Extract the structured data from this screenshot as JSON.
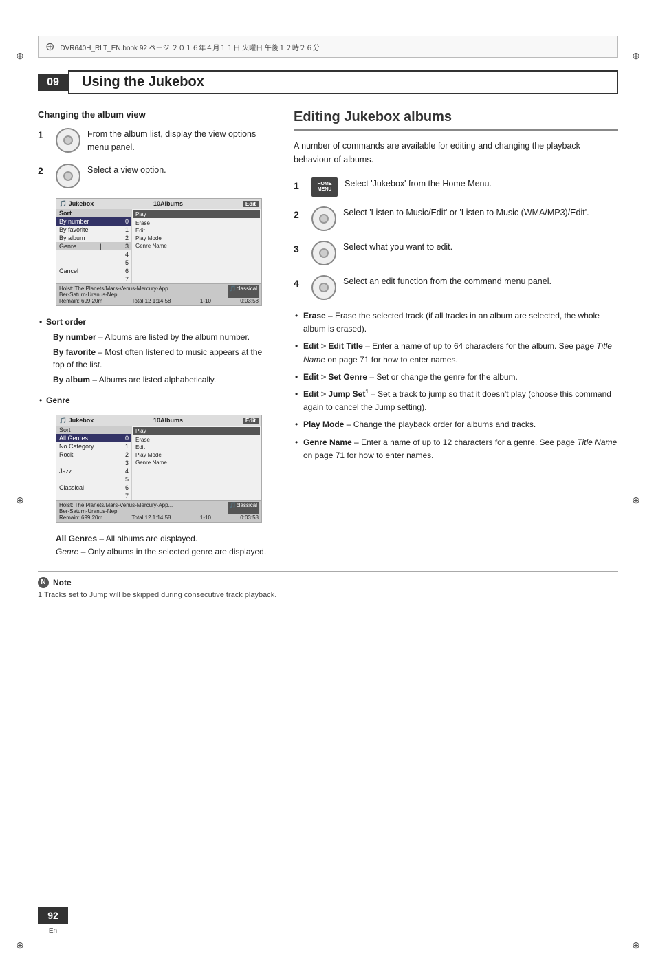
{
  "page": {
    "number": "92",
    "lang": "En"
  },
  "topbar": {
    "text": "DVR640H_RLT_EN.book  92 ページ  ２０１６年４月１１日  火曜日  午後１２時２６分"
  },
  "chapter": {
    "number": "09",
    "title": "Using the Jukebox"
  },
  "left": {
    "section_title": "Changing the album view",
    "steps": [
      {
        "num": "1",
        "text": "From the album list, display the view options menu panel."
      },
      {
        "num": "2",
        "text": "Select a view option."
      }
    ],
    "bullets": [
      {
        "heading": "Sort order",
        "items": [
          {
            "label": "By number",
            "desc": "– Albums are listed by the album number."
          },
          {
            "label": "By favorite",
            "desc": "– Most often listened to music appears at the top of the list."
          },
          {
            "label": "By album",
            "desc": "– Albums are listed alphabetically."
          }
        ]
      },
      {
        "heading": "Genre",
        "items": []
      }
    ],
    "genre_desc": [
      {
        "label": "All Genres",
        "desc": "– All albums are displayed."
      },
      {
        "label": "Genre",
        "desc": "– Only albums in the selected genre are displayed.",
        "italic": true
      }
    ],
    "screen1": {
      "title": "Jukebox",
      "count": "10Albums",
      "menu_label": "Sort",
      "menu_items": [
        "By number",
        "By favorite",
        "By album"
      ],
      "genre_label": "Genre",
      "cancel": "Cancel",
      "right_items": [
        "Play",
        "Erase",
        "Edit",
        "Play Mode",
        "Genre Name"
      ],
      "numbers": [
        "0",
        "1",
        "2",
        "3",
        "4",
        "5",
        "6",
        "7"
      ],
      "footer": "Remain: 699:20m",
      "footer2": "Total 12  1:14:58",
      "footer3": "1-10",
      "footer4": "0:03:58"
    },
    "screen2": {
      "title": "Jukebox",
      "count": "10Albums",
      "menu_label": "Sort",
      "genre_label": "All Genres",
      "genre_items": [
        "No Category",
        "Rock",
        "Jazz",
        "Classical"
      ],
      "right_items": [
        "Play",
        "Erase",
        "Edit",
        "Play Mode",
        "Genre Name"
      ],
      "numbers": [
        "0",
        "1",
        "2",
        "3",
        "4",
        "5",
        "6",
        "7"
      ],
      "footer": "Remain: 699:20m",
      "footer2": "Total 12  1:14:58",
      "footer3": "1-10",
      "footer4": "0:03:58"
    }
  },
  "right": {
    "heading": "Editing Jukebox albums",
    "intro": "A number of commands are available for editing and changing the playback behaviour of albums.",
    "steps": [
      {
        "num": "1",
        "icon": "home-menu",
        "text": "Select 'Jukebox' from the Home Menu."
      },
      {
        "num": "2",
        "icon": "wheel",
        "text": "Select 'Listen to Music/Edit' or 'Listen to Music (WMA/MP3)/Edit'."
      },
      {
        "num": "3",
        "icon": "wheel",
        "text": "Select what you want to edit."
      },
      {
        "num": "4",
        "icon": "wheel",
        "text": "Select an edit function from the command menu panel."
      }
    ],
    "edit_bullets": [
      {
        "label": "Erase",
        "desc": "– Erase the selected track (if all tracks in an album are selected, the whole album is erased)."
      },
      {
        "label": "Edit > Edit Title",
        "desc": "– Enter a name of up to 64 characters for the album. See page Title Name on page 71 for how to enter names.",
        "italic_ref": "Title Name"
      },
      {
        "label": "Edit > Set Genre",
        "desc": "– Set or change the genre for the album."
      },
      {
        "label": "Edit > Jump Set",
        "sup": "1",
        "desc": "– Set a track to jump so that it doesn't play (choose this command again to cancel the Jump setting)."
      },
      {
        "label": "Play Mode",
        "desc": "– Change the playback order for albums and tracks."
      },
      {
        "label": "Genre Name",
        "desc": "– Enter a name of up to 12 characters for a genre. See page Title Name on page 71 for how to enter names.",
        "italic_ref": "Title Name"
      }
    ]
  },
  "note": {
    "label": "Note",
    "items": [
      "1 Tracks set to Jump will be skipped during consecutive track playback."
    ]
  }
}
